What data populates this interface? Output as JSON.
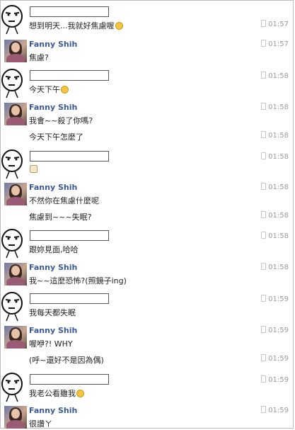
{
  "groups": [
    {
      "sender": "",
      "avatar": "meme-face-avatar",
      "messages": [
        {
          "text": "想到明天...我就好焦慮喔",
          "emoticon": "wink-smiley-icon",
          "time": "01:57"
        }
      ]
    },
    {
      "sender": "Fanny Shih",
      "avatar": "fanny-photo-avatar",
      "messages": [
        {
          "text": "焦慮?",
          "time": "01:57"
        }
      ]
    },
    {
      "sender": "",
      "avatar": "meme-face-avatar",
      "messages": [
        {
          "text": "今天下午",
          "emoticon": "sad-smiley-icon",
          "time": "01:58"
        }
      ]
    },
    {
      "sender": "Fanny Shih",
      "avatar": "fanny-photo-avatar",
      "messages": [
        {
          "text": "我會~~殺了你嗎?",
          "time": "01:58"
        },
        {
          "text": "今天下午怎麼了",
          "time": "01:58"
        }
      ]
    },
    {
      "sender": "",
      "avatar": "meme-face-avatar",
      "messages": [
        {
          "text": "",
          "emoticon": "gift-box-icon",
          "time": "01:58"
        }
      ]
    },
    {
      "sender": "Fanny Shih",
      "avatar": "fanny-photo-avatar",
      "messages": [
        {
          "text": "不然你在焦慮什麼呢",
          "time": "01:58"
        },
        {
          "text": "焦慮到~~~失眠?",
          "time": "01:58"
        }
      ]
    },
    {
      "sender": "",
      "avatar": "meme-face-avatar",
      "messages": [
        {
          "text": "跟妳見面,哈哈",
          "time": "01:58"
        }
      ]
    },
    {
      "sender": "Fanny Shih",
      "avatar": "fanny-photo-avatar",
      "messages": [
        {
          "text": "我~~這麼恐怖?(照鏡子ing)",
          "time": "01:58"
        }
      ]
    },
    {
      "sender": "",
      "avatar": "meme-face-avatar",
      "messages": [
        {
          "text": "我每天都失眠",
          "time": "01:59"
        }
      ]
    },
    {
      "sender": "Fanny Shih",
      "avatar": "fanny-photo-avatar",
      "messages": [
        {
          "text": "喔咿?! WHY",
          "time": "01:59"
        },
        {
          "text": "(呼~還好不是因為偶)",
          "time": "01:59"
        }
      ]
    },
    {
      "sender": "",
      "avatar": "meme-face-avatar",
      "messages": [
        {
          "text": "我老公看雖我",
          "emoticon": "sad-smiley-icon",
          "time": "01:59"
        }
      ]
    },
    {
      "sender": "Fanny Shih",
      "avatar": "fanny-photo-avatar",
      "messages": [
        {
          "text": "很讚ㄚ",
          "time": "01:59"
        }
      ]
    }
  ]
}
